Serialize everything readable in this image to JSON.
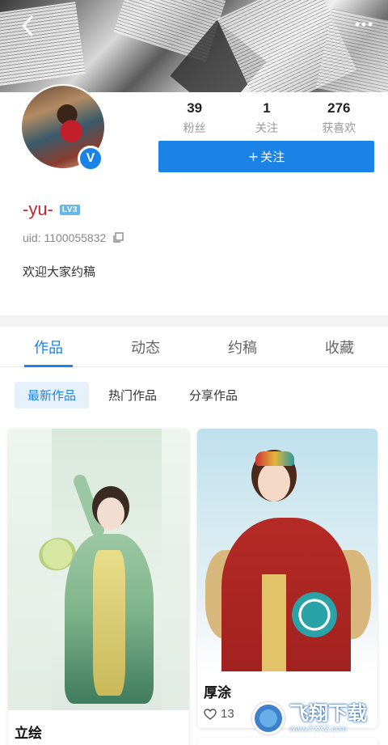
{
  "header": {
    "back_icon": "back-arrow-icon",
    "more_icon": "more-dots-icon"
  },
  "profile": {
    "verified_mark": "V",
    "stats": [
      {
        "num": "39",
        "label": "粉丝"
      },
      {
        "num": "1",
        "label": "关注"
      },
      {
        "num": "276",
        "label": "获喜欢"
      }
    ],
    "follow_plus": "+",
    "follow_label": "关注",
    "username": "-yu-",
    "level": "LV3",
    "uid": "uid: 1100055832",
    "bio": "欢迎大家约稿"
  },
  "tabs": [
    {
      "label": "作品",
      "active": true
    },
    {
      "label": "动态",
      "active": false
    },
    {
      "label": "约稿",
      "active": false
    },
    {
      "label": "收藏",
      "active": false
    }
  ],
  "subtabs": [
    {
      "label": "最新作品",
      "active": true
    },
    {
      "label": "热门作品",
      "active": false
    },
    {
      "label": "分享作品",
      "active": false
    }
  ],
  "works": [
    {
      "title": "立绘"
    },
    {
      "title": "厚涂",
      "likes": "13"
    }
  ],
  "watermark": {
    "text": "飞翔下载",
    "sub": "www.FXXZ.com"
  },
  "colors": {
    "accent": "#1b82e6",
    "username": "#c0282a"
  }
}
